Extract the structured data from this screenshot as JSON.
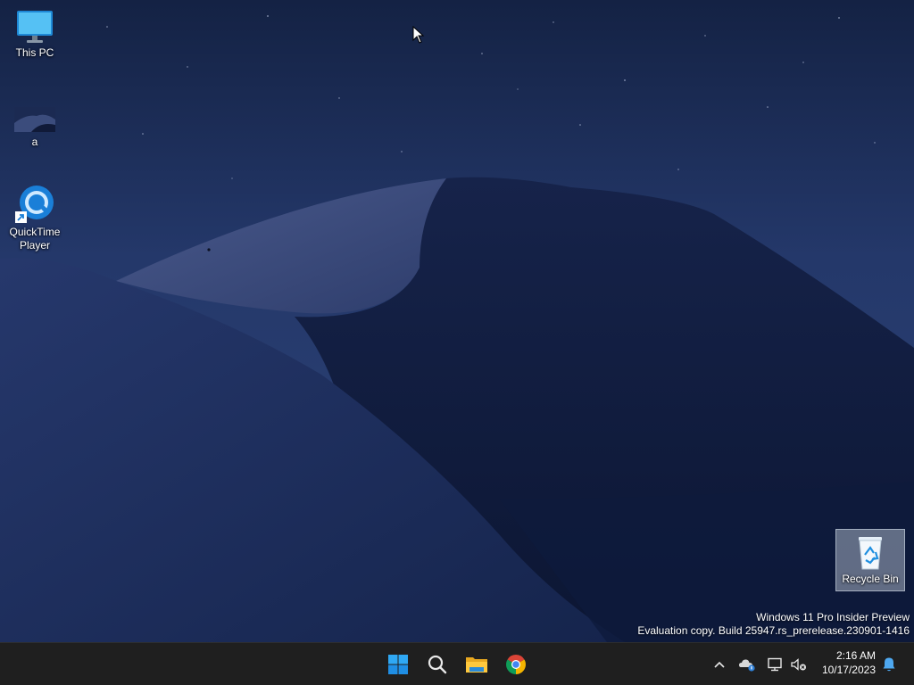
{
  "desktop": {
    "icons": [
      {
        "label": "This PC",
        "icon": "monitor-icon"
      },
      {
        "label": "a",
        "icon": "image-thumbnail-icon"
      },
      {
        "label": "QuickTime Player",
        "icon": "quicktime-icon",
        "shortcut": true
      },
      {
        "label": "Recycle Bin",
        "icon": "recycle-bin-icon",
        "selected": true
      }
    ],
    "watermark": {
      "line1": "Windows 11 Pro Insider Preview",
      "line2": "Evaluation copy. Build 25947.rs_prerelease.230901-1416"
    }
  },
  "taskbar": {
    "apps": [
      {
        "name": "Start",
        "icon": "windows-start-icon"
      },
      {
        "name": "Search",
        "icon": "search-icon"
      },
      {
        "name": "File Explorer",
        "icon": "folder-icon"
      },
      {
        "name": "Google Chrome",
        "icon": "chrome-icon"
      }
    ],
    "tray": {
      "icons": [
        "chevron-up-icon",
        "onedrive-icon",
        "network-icon",
        "volume-muted-icon",
        "bell-icon"
      ],
      "time": "2:16 AM",
      "date": "10/17/2023"
    }
  },
  "colors": {
    "taskbar_bg": "#1f1f1f",
    "sky": "#1c2c52",
    "accent": "#0078d4"
  }
}
